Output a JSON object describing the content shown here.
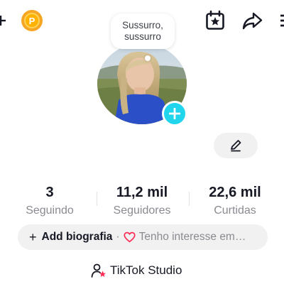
{
  "header": {
    "coin_badge": "P",
    "icons": [
      "plus-icon",
      "coin-icon",
      "calendar-star-icon",
      "share-icon",
      "menu-icon"
    ]
  },
  "profile": {
    "note": "Sussurro, sussurro",
    "avatar_add_icon": "plus-icon"
  },
  "edit": {
    "icon": "pencil-icon"
  },
  "stats": [
    {
      "value": "3",
      "label": "Seguindo"
    },
    {
      "value": "11,2 mil",
      "label": "Seguidores"
    },
    {
      "value": "22,6 mil",
      "label": "Curtidas"
    }
  ],
  "bio": {
    "plus": "+",
    "add_label": "Add biografia",
    "separator": "·",
    "interest_label": "Tenho interesse em…"
  },
  "studio": {
    "label": "TikTok Studio",
    "icon": "person-star-icon"
  },
  "colors": {
    "accent": "#20d5ec",
    "heart": "#fe2c55",
    "studio_star": "#fe2c55",
    "coin": "#ffb300",
    "pill_bg": "#f1f1f2",
    "muted_text": "#8a8b91"
  }
}
